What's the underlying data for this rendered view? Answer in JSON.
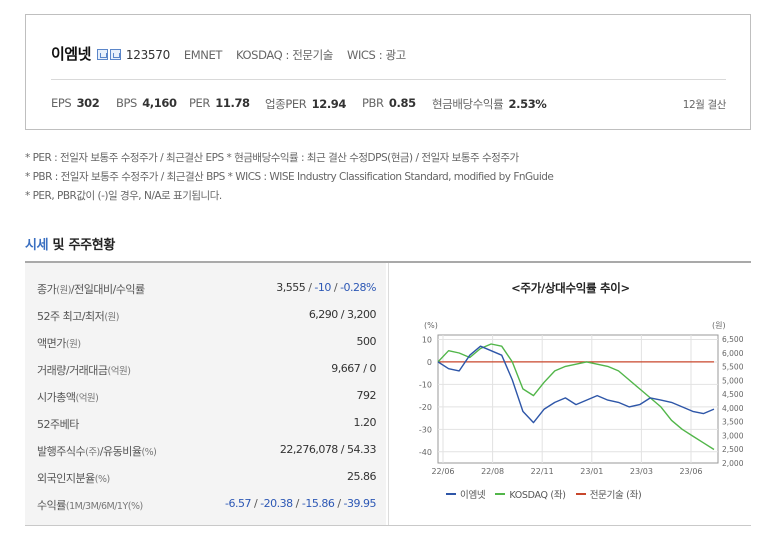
{
  "company": {
    "name": "이엠넷",
    "code": "123570",
    "english": "EMNET",
    "market": "KOSDAQ : 전문기술",
    "wics": "WICS : 광고"
  },
  "metrics": [
    {
      "label": "EPS",
      "value": "302"
    },
    {
      "label": "BPS",
      "value": "4,160"
    },
    {
      "label": "PER",
      "value": "11.78"
    },
    {
      "label": "업종PER",
      "value": "12.94"
    },
    {
      "label": "PBR",
      "value": "0.85"
    },
    {
      "label": "현금배당수익률",
      "value": "2.53%"
    }
  ],
  "settlement": "12월 결산",
  "notes": [
    "* PER : 전일자 보통주 수정주가 / 최근결산 EPS * 현금배당수익률 : 최근 결산 수정DPS(현금) / 전일자 보통주 수정주가",
    "* PBR : 전일자 보통주 수정주가 / 최근결산 BPS * WICS : WISE Industry Classification Standard, modified by FnGuide",
    "* PER, PBR값이 (-)일 경우, N/A로 표기됩니다."
  ],
  "section": {
    "highlight": "시세",
    "rest": " 및 주주현황"
  },
  "stats": [
    {
      "label": "종가",
      "unit": "(원)",
      "suffix": "/전일대비/수익률",
      "v1": "3,555",
      "v2": "-10",
      "v3": "-0.28%"
    },
    {
      "label": "52주 최고/최저",
      "unit": "(원)",
      "value": "6,290 / 3,200"
    },
    {
      "label": "액면가",
      "unit": "(원)",
      "value": "500"
    },
    {
      "label": "거래량/거래대금",
      "unit": "(억원)",
      "value": "9,667 / 0"
    },
    {
      "label": "시가총액",
      "unit": "(억원)",
      "value": "792"
    },
    {
      "label": "52주베타",
      "unit": "",
      "value": "1.20"
    },
    {
      "label": "발행주식수",
      "unit": "(주)",
      "suffix": "/유동비율",
      "unit2": "(%)",
      "value": "22,276,078 / 54.33"
    },
    {
      "label": "외국인지분율",
      "unit": "(%)",
      "value": "25.86"
    },
    {
      "label": "수익률",
      "unit": "(1M/3M/6M/1Y(%)",
      "r": [
        "-6.57",
        "-20.38",
        "-15.86",
        "-39.95"
      ]
    }
  ],
  "chart_data": {
    "type": "line",
    "title": "<주가/상대수익률 추이>",
    "left_unit": "(%)",
    "right_unit": "(원)",
    "x_ticks": [
      "22/06",
      "22/08",
      "22/11",
      "23/01",
      "23/03",
      "23/06"
    ],
    "y_left_ticks": [
      "10",
      "0",
      "-10",
      "-20",
      "-30",
      "-40"
    ],
    "y_right_ticks": [
      "6,500",
      "6,000",
      "5,500",
      "5,000",
      "4,500",
      "4,000",
      "3,500",
      "3,000",
      "2,500",
      "2,000"
    ],
    "ylim_left": [
      -45,
      12
    ],
    "grid": true,
    "legend_position": "bottom",
    "series": [
      {
        "name": "이엠넷",
        "color": "#2e56a8",
        "values": [
          0,
          -3,
          -4,
          3,
          7,
          5,
          3,
          -8,
          -22,
          -27,
          -21,
          -18,
          -16,
          -19,
          -17,
          -15,
          -17,
          -18,
          -20,
          -19,
          -16,
          -17,
          -18,
          -20,
          -22,
          -23,
          -21
        ]
      },
      {
        "name": "KOSDAQ (좌)",
        "color": "#52b64a",
        "values": [
          0,
          5,
          4,
          2,
          6,
          8,
          7,
          0,
          -12,
          -15,
          -9,
          -4,
          -2,
          -1,
          0,
          -1,
          -2,
          -4,
          -8,
          -12,
          -16,
          -20,
          -26,
          -30,
          -33,
          -36,
          -39
        ]
      },
      {
        "name": "전문기술 (좌)",
        "color": "#c8472c",
        "values": [
          0,
          0,
          0,
          0,
          0,
          0,
          0,
          0,
          0,
          0,
          0,
          0,
          0,
          0,
          0,
          0,
          0,
          0,
          0,
          0,
          0,
          0,
          0,
          0,
          0,
          0,
          0
        ]
      }
    ]
  }
}
